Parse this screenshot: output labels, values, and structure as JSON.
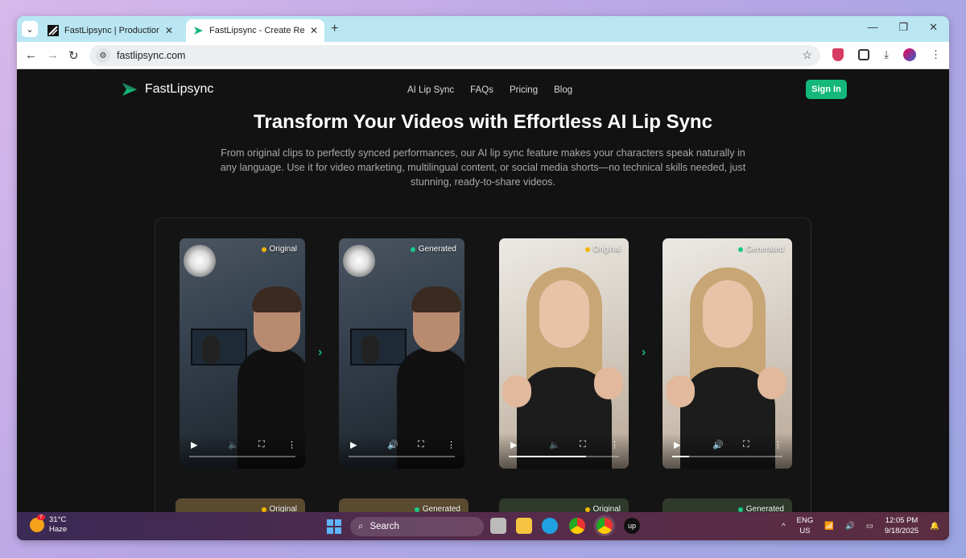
{
  "browser": {
    "tabs": [
      {
        "title": "FastLipsync | Production | Sanity"
      },
      {
        "title": "FastLipsync - Create Realistic Lip"
      }
    ],
    "url": "fastlipsync.com"
  },
  "site": {
    "logo_text": "FastLipsync",
    "nav": [
      "AI Lip Sync",
      "FAQs",
      "Pricing",
      "Blog"
    ],
    "signin_label": "Sign In",
    "hero_title": "Transform Your Videos with Effortless AI Lip Sync",
    "hero_subtitle": "From original clips to perfectly synced performances, our AI lip sync feature makes your characters speak naturally in any language. Use it for video marketing, multilingual content, or social media shorts—no technical skills needed, just stunning, ready-to-share videos.",
    "badges": {
      "original": "Original",
      "generated": "Generated"
    },
    "colors": {
      "accent": "#14b87a",
      "original_dot": "#f5b400",
      "generated_dot": "#19c78a"
    },
    "videos": [
      {
        "badge": "Original",
        "muted": true,
        "progress": 0
      },
      {
        "badge": "Generated",
        "muted": false,
        "progress": 0
      },
      {
        "badge": "Original",
        "muted": true,
        "progress": 0.7
      },
      {
        "badge": "Generated",
        "muted": false,
        "progress": 0.15
      }
    ]
  },
  "taskbar": {
    "weather_temp": "31°C",
    "weather_desc": "Haze",
    "weather_alerts": "7",
    "search_placeholder": "Search",
    "lang_top": "ENG",
    "lang_bottom": "US",
    "time": "12:05 PM",
    "date": "9/18/2025"
  }
}
